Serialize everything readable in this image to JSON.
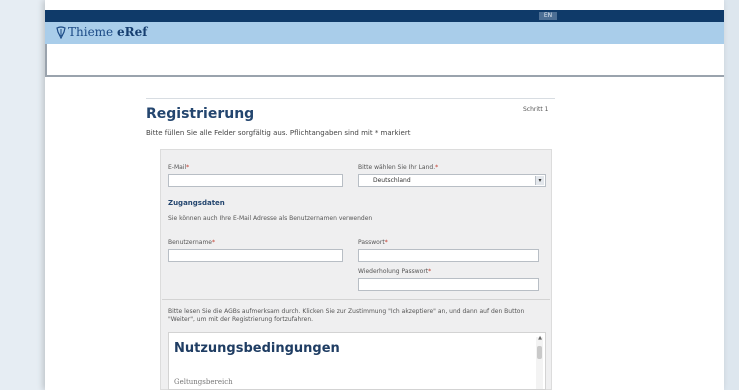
{
  "header": {
    "lang_button": "EN",
    "brand_name": "Thieme",
    "brand_product": "eRef"
  },
  "page": {
    "title": "Registrierung",
    "step": "Schritt 1",
    "subtitle": "Bitte füllen Sie alle Felder sorgfältig aus. Pflichtangaben sind mit * markiert"
  },
  "form": {
    "email_label": "E-Mail",
    "email_value": "",
    "country_label": "Bitte wählen Sie Ihr Land.",
    "country_value": "Deutschland",
    "access_heading": "Zugangsdaten",
    "access_hint": "Sie können auch Ihre E-Mail Adresse als Benutzernamen verwenden",
    "username_label": "Benutzername",
    "username_value": "",
    "password_label": "Passwort",
    "password_value": "",
    "password_repeat_label": "Wiederholung Passwort",
    "password_repeat_value": "",
    "required_marker": "*",
    "agb_text": "Bitte lesen Sie die AGBs aufmerksam durch. Klicken Sie zur Zustimmung \"Ich akzeptiere\" an, und dann auf den Button \"Weiter\", um mit der Registrierung fortzufahren."
  },
  "terms": {
    "title": "Nutzungsbedingungen",
    "first_section": "Geltungsbereich"
  },
  "colors": {
    "top_bar": "#0f3a69",
    "brand_bar": "#a9cdea",
    "accent_text": "#24466f",
    "required": "#c0392b"
  },
  "icons": {
    "brand": "thieme-logo-icon",
    "select": "chevron-down-icon",
    "scroll_up": "arrow-up-icon"
  }
}
